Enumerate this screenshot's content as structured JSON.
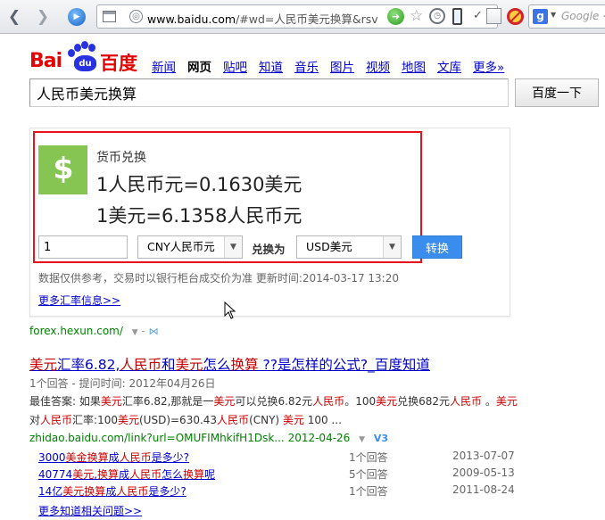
{
  "browser": {
    "url_host": "www.baidu.com",
    "url_rest": "/#wd=人民币美元换算&rsv_spt=1",
    "search_placeholder": "Google <"
  },
  "logo": {
    "latin": "Bai",
    "paw": "du",
    "chinese": "百度"
  },
  "nav": {
    "items": [
      {
        "label": "新闻",
        "active": false
      },
      {
        "label": "网页",
        "active": true
      },
      {
        "label": "贴吧",
        "active": false
      },
      {
        "label": "知道",
        "active": false
      },
      {
        "label": "音乐",
        "active": false
      },
      {
        "label": "图片",
        "active": false
      },
      {
        "label": "视频",
        "active": false
      },
      {
        "label": "地图",
        "active": false
      },
      {
        "label": "文库",
        "active": false
      },
      {
        "label": "更多»",
        "active": false
      }
    ]
  },
  "search": {
    "query": "人民币美元换算",
    "button_label": "百度一下"
  },
  "converter": {
    "title": "货币兑换",
    "rate_cny_to_usd": "1人民币元=0.1630美元",
    "rate_usd_to_cny": "1美元=6.1358人民币元",
    "amount": "1",
    "from_currency": "CNY人民币元",
    "convert_to_label": "兑换为",
    "to_currency": "USD美元",
    "convert_button": "转换",
    "disclaimer": "数据仅供参考，交易时以银行柜台成交价为准 更新时间:2014-03-17 13:20",
    "more_rates_link": "更多汇率信息>>",
    "source_url": "forex.hexun.com/",
    "accent_color": "#86c552",
    "highlight_color": "#e8121d"
  },
  "result": {
    "title_segments": [
      {
        "text": "美元",
        "hl": true
      },
      {
        "text": "汇率6.82,",
        "hl": false
      },
      {
        "text": "人民币",
        "hl": true
      },
      {
        "text": "和",
        "hl": false
      },
      {
        "text": "美元",
        "hl": true
      },
      {
        "text": "怎么",
        "hl": false
      },
      {
        "text": "换算",
        "hl": true
      },
      {
        "text": " ??是怎样的公式?_百度知道",
        "hl": false
      }
    ],
    "meta": "1个回答 - 提问时间: 2012年04月26日",
    "snippet_segments": [
      {
        "text": "最佳答案: 如果",
        "hl": false
      },
      {
        "text": "美元",
        "hl": true
      },
      {
        "text": "汇率6.82,那就是一",
        "hl": false
      },
      {
        "text": "美元",
        "hl": true
      },
      {
        "text": "可以兑换6.82元",
        "hl": false
      },
      {
        "text": "人民币",
        "hl": true
      },
      {
        "text": "。100",
        "hl": false
      },
      {
        "text": "美元",
        "hl": true
      },
      {
        "text": "兑换682元",
        "hl": false
      },
      {
        "text": "人民币",
        "hl": true
      },
      {
        "text": " 。",
        "hl": false
      },
      {
        "text": "美元",
        "hl": true
      },
      {
        "text": "对",
        "hl": false
      },
      {
        "text": "人民币",
        "hl": true
      },
      {
        "text": "汇率:100",
        "hl": false
      },
      {
        "text": "美元",
        "hl": true
      },
      {
        "text": "(USD)=630.43",
        "hl": false
      },
      {
        "text": "人民币",
        "hl": true
      },
      {
        "text": "(CNY) ",
        "hl": false
      },
      {
        "text": "美元",
        "hl": true
      },
      {
        "text": " 100 ...",
        "hl": false
      }
    ],
    "url": "zhidao.baidu.com/link?url=OMUFIMhkifH1Dsk...",
    "url_date": "2012-04-26",
    "verified_badge": "V3",
    "related_questions": [
      {
        "segments": [
          {
            "text": "3000",
            "hl": false
          },
          {
            "text": "美金",
            "hl": true
          },
          {
            "text": "换算",
            "hl": true
          },
          {
            "text": "成",
            "hl": false
          },
          {
            "text": "人民币",
            "hl": true
          },
          {
            "text": "是多少?",
            "hl": false
          }
        ],
        "answers": "1个回答",
        "date": "2013-07-07"
      },
      {
        "segments": [
          {
            "text": "40774",
            "hl": false
          },
          {
            "text": "美元",
            "hl": true
          },
          {
            "text": ",",
            "hl": false
          },
          {
            "text": "换算",
            "hl": true
          },
          {
            "text": "成",
            "hl": false
          },
          {
            "text": "人民币",
            "hl": true
          },
          {
            "text": "怎么",
            "hl": false
          },
          {
            "text": "换算",
            "hl": true
          },
          {
            "text": "呢",
            "hl": false
          }
        ],
        "answers": "5个回答",
        "date": "2009-05-13"
      },
      {
        "segments": [
          {
            "text": "14亿",
            "hl": false
          },
          {
            "text": "美元",
            "hl": true
          },
          {
            "text": "换算",
            "hl": true
          },
          {
            "text": "成",
            "hl": false
          },
          {
            "text": "人民币",
            "hl": true
          },
          {
            "text": "是多少?",
            "hl": false
          }
        ],
        "answers": "1个回答",
        "date": "2011-08-24"
      }
    ],
    "more_link": "更多知道相关问题>>"
  }
}
